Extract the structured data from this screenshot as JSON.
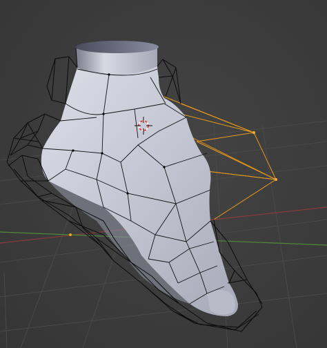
{
  "viewport": {
    "label": "3D Viewport",
    "background_color": "#3d3d3d",
    "grid_color": "#4a4a4a",
    "x_axis_color": "#8b3a3a",
    "y_axis_color": "#4f8a3a",
    "cage_wire_color": "#0b0b0b",
    "selected_wire_color": "#f0a020",
    "mesh_surface_color": "#c8cad6",
    "mesh_edge_color": "#101010"
  },
  "objects": [
    {
      "name": "foot-mesh",
      "type": "subdivided mesh",
      "icon": "mesh-icon"
    },
    {
      "name": "lattice-cage",
      "type": "wireframe cage",
      "icon": "lattice-icon"
    }
  ],
  "cursor": {
    "icon": "3d-cursor-icon"
  },
  "origin": {
    "icon": "object-origin-icon",
    "color": "#f0a020"
  }
}
